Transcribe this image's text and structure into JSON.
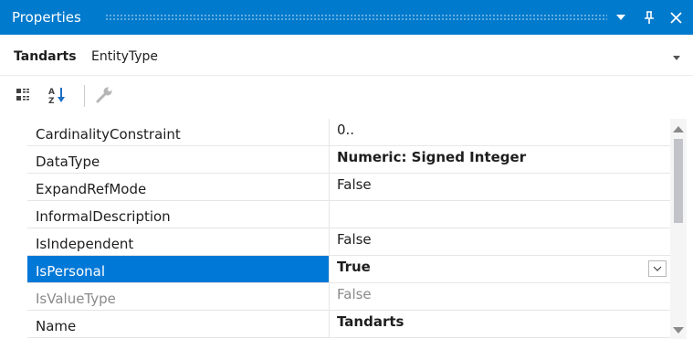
{
  "window": {
    "title": "Properties",
    "icons": [
      "dropdown-arrow-icon",
      "pin-icon",
      "close-icon"
    ],
    "accent_color": "#007acc"
  },
  "object_selector": {
    "name": "Tandarts",
    "type": "EntityType"
  },
  "toolbar": {
    "icons": [
      "categorized-icon",
      "alphabetical-sort-icon",
      "property-pages-icon"
    ]
  },
  "properties": [
    {
      "name": "CardinalityConstraint",
      "value": "0.."
    },
    {
      "name": "DataType",
      "value": "Numeric: Signed Integer"
    },
    {
      "name": "ExpandRefMode",
      "value": "False"
    },
    {
      "name": "InformalDescription",
      "value": ""
    },
    {
      "name": "IsIndependent",
      "value": "False"
    },
    {
      "name": "IsPersonal",
      "value": "True"
    },
    {
      "name": "IsValueType",
      "value": "False"
    },
    {
      "name": "Name",
      "value": "Tandarts"
    }
  ],
  "selection_color": "#0078d7"
}
